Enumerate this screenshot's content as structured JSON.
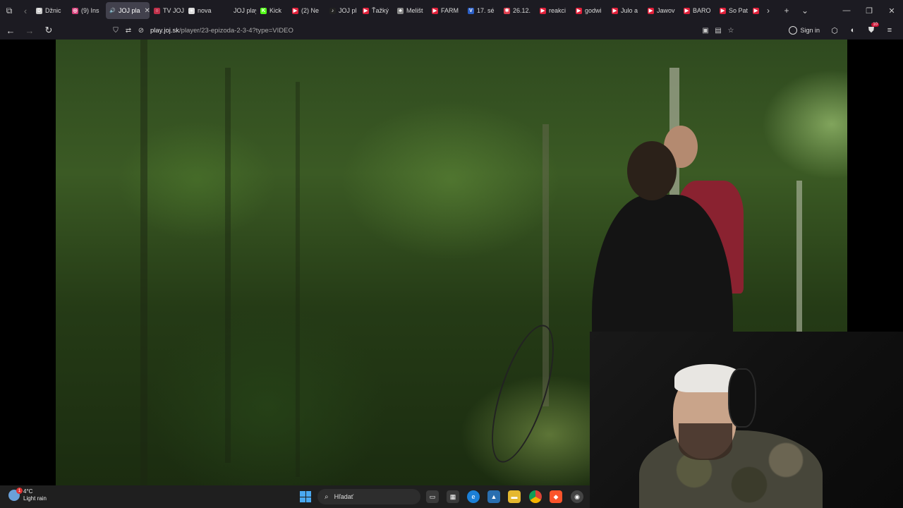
{
  "browser": {
    "tabs": [
      {
        "label": "Džnic",
        "fav_color": "#c8c8c8",
        "fav_glyph": "D"
      },
      {
        "label": "(9) Ins",
        "fav_color": "#d6407a",
        "fav_glyph": "◎"
      },
      {
        "label": "JOJ pla",
        "fav_color": "transparent",
        "fav_glyph": "🔊",
        "active": true
      },
      {
        "label": "TV JOJ",
        "fav_color": "#c0304a",
        "fav_glyph": "○"
      },
      {
        "label": "nova",
        "fav_color": "#dddddd",
        "fav_glyph": "●"
      },
      {
        "label": "JOJ play",
        "fav_color": "transparent",
        "fav_glyph": ""
      },
      {
        "label": "Kick",
        "fav_color": "#53fc18",
        "fav_glyph": "K"
      },
      {
        "label": "(2) Ne",
        "fav_color": "#e0203a",
        "fav_glyph": "▶"
      },
      {
        "label": "JOJ pl",
        "fav_color": "#222222",
        "fav_glyph": "♪"
      },
      {
        "label": "Ťažký",
        "fav_color": "#e0203a",
        "fav_glyph": "▶"
      },
      {
        "label": "Melišt",
        "fav_color": "#888888",
        "fav_glyph": "♣"
      },
      {
        "label": "FARM",
        "fav_color": "#e0203a",
        "fav_glyph": "▶"
      },
      {
        "label": "17. sé",
        "fav_color": "#2b5fc6",
        "fav_glyph": "V"
      },
      {
        "label": "26.12.",
        "fav_color": "#e04050",
        "fav_glyph": "✱"
      },
      {
        "label": "reakci",
        "fav_color": "#e0203a",
        "fav_glyph": "▶"
      },
      {
        "label": "godwi",
        "fav_color": "#e0203a",
        "fav_glyph": "▶"
      },
      {
        "label": "Julo a",
        "fav_color": "#e0203a",
        "fav_glyph": "▶"
      },
      {
        "label": "Jawov",
        "fav_color": "#e0203a",
        "fav_glyph": "▶"
      },
      {
        "label": "BARO",
        "fav_color": "#e0203a",
        "fav_glyph": "▶"
      },
      {
        "label": "So Pat",
        "fav_color": "#e0203a",
        "fav_glyph": "▶"
      },
      {
        "label": "",
        "fav_color": "#e0203a",
        "fav_glyph": "▶"
      }
    ],
    "url_host": "play.joj.sk",
    "url_path": "/player/23-epizoda-2-3-4?type=VIDEO",
    "sign_in_label": "Sign in",
    "extension_badge": "10"
  },
  "taskbar": {
    "weather_temp": "4°C",
    "weather_desc": "Light rain",
    "weather_badge": "1",
    "search_placeholder": "Hľadať"
  },
  "colors": {
    "browser_chrome": "#1c1b22",
    "active_tab": "#42414d",
    "taskbar": "#1f1f1f",
    "windows_accent": "#4aa8f0"
  }
}
